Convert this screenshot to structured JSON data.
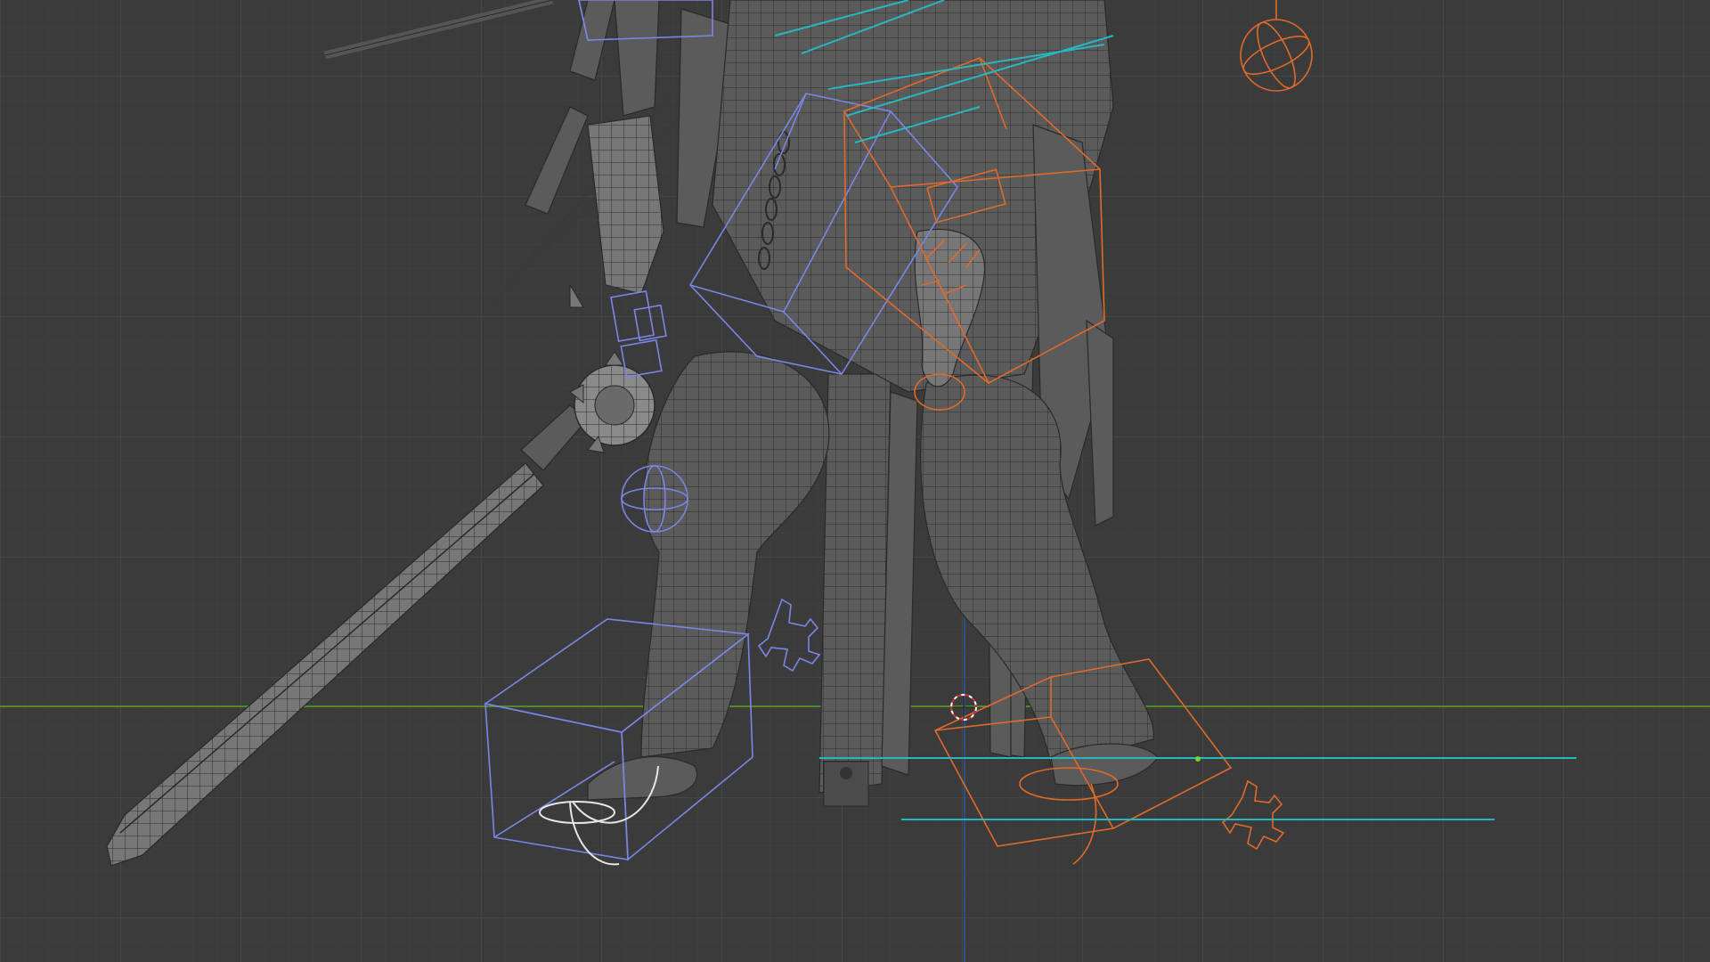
{
  "viewport": {
    "background": "#3b3b3b",
    "grid_color": "#464646",
    "x_axis_color": "#4e8a2a",
    "z_axis_color": "#2b4f86"
  },
  "scene": {
    "object_colors": {
      "mesh": "#5b5b5b",
      "control_blue": "#7a86e6",
      "control_orange": "#e06a2a",
      "control_cyan": "#27b7c0",
      "control_white": "#e6e6e6"
    },
    "icons": [
      "orange-sphere-gizmo-icon",
      "blue-gear-gizmo-icon",
      "orange-gear-gizmo-icon",
      "cursor-3d-icon",
      "blue-sphere-gizmo-icon"
    ]
  }
}
